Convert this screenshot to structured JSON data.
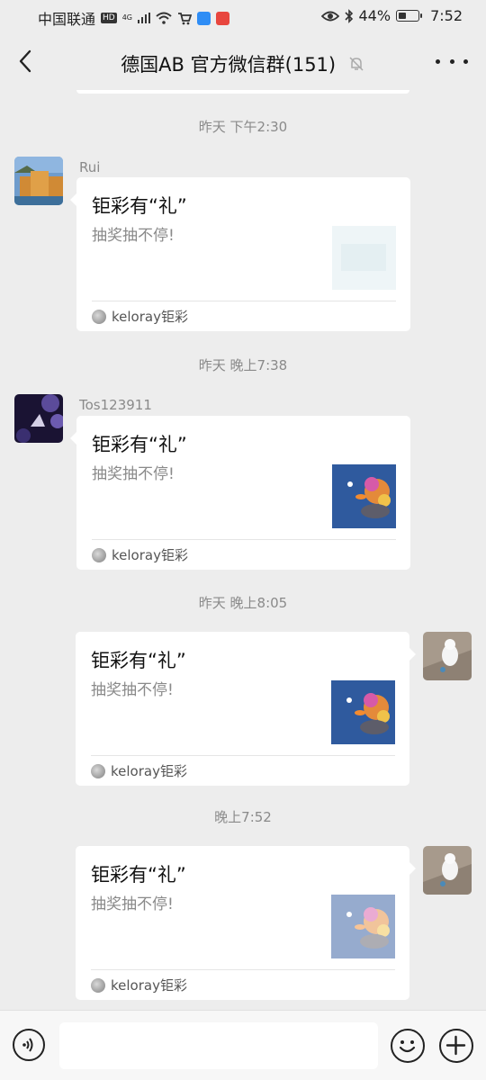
{
  "status_bar": {
    "carrier": "中国联通",
    "hd": "HD",
    "network": "4G",
    "battery": "44%",
    "battery_level": 0.44,
    "time": "7:52"
  },
  "header": {
    "title": "德国AB  官方微信群(151)",
    "back_icon": "chevron-left-icon",
    "mute_icon": "bell-off-icon",
    "more_icon": "more-dots-icon"
  },
  "messages": [
    {
      "time": "昨天 下午2:30",
      "sender": "Rui",
      "mine": false,
      "card": {
        "title": "钜彩有“礼”",
        "desc": "抽奖抽不停!",
        "source": "keloray钜彩"
      }
    },
    {
      "time": "昨天 晚上7:38",
      "sender": "Tos123911",
      "mine": false,
      "card": {
        "title": "钜彩有“礼”",
        "desc": "抽奖抽不停!",
        "source": "keloray钜彩"
      }
    },
    {
      "time": "昨天 晚上8:05",
      "sender": "",
      "mine": true,
      "card": {
        "title": "钜彩有“礼”",
        "desc": "抽奖抽不停!",
        "source": "keloray钜彩"
      }
    },
    {
      "time": "晚上7:52",
      "sender": "",
      "mine": true,
      "card": {
        "title": "钜彩有“礼”",
        "desc": "抽奖抽不停!",
        "source": "keloray钜彩"
      }
    }
  ],
  "input_bar": {
    "voice_icon": "voice-icon",
    "text_value": "",
    "emoji_icon": "emoji-icon",
    "plus_icon": "plus-icon"
  },
  "colors": {
    "background": "#ededed",
    "card": "#ffffff",
    "meta_text": "#8a8a8a"
  }
}
